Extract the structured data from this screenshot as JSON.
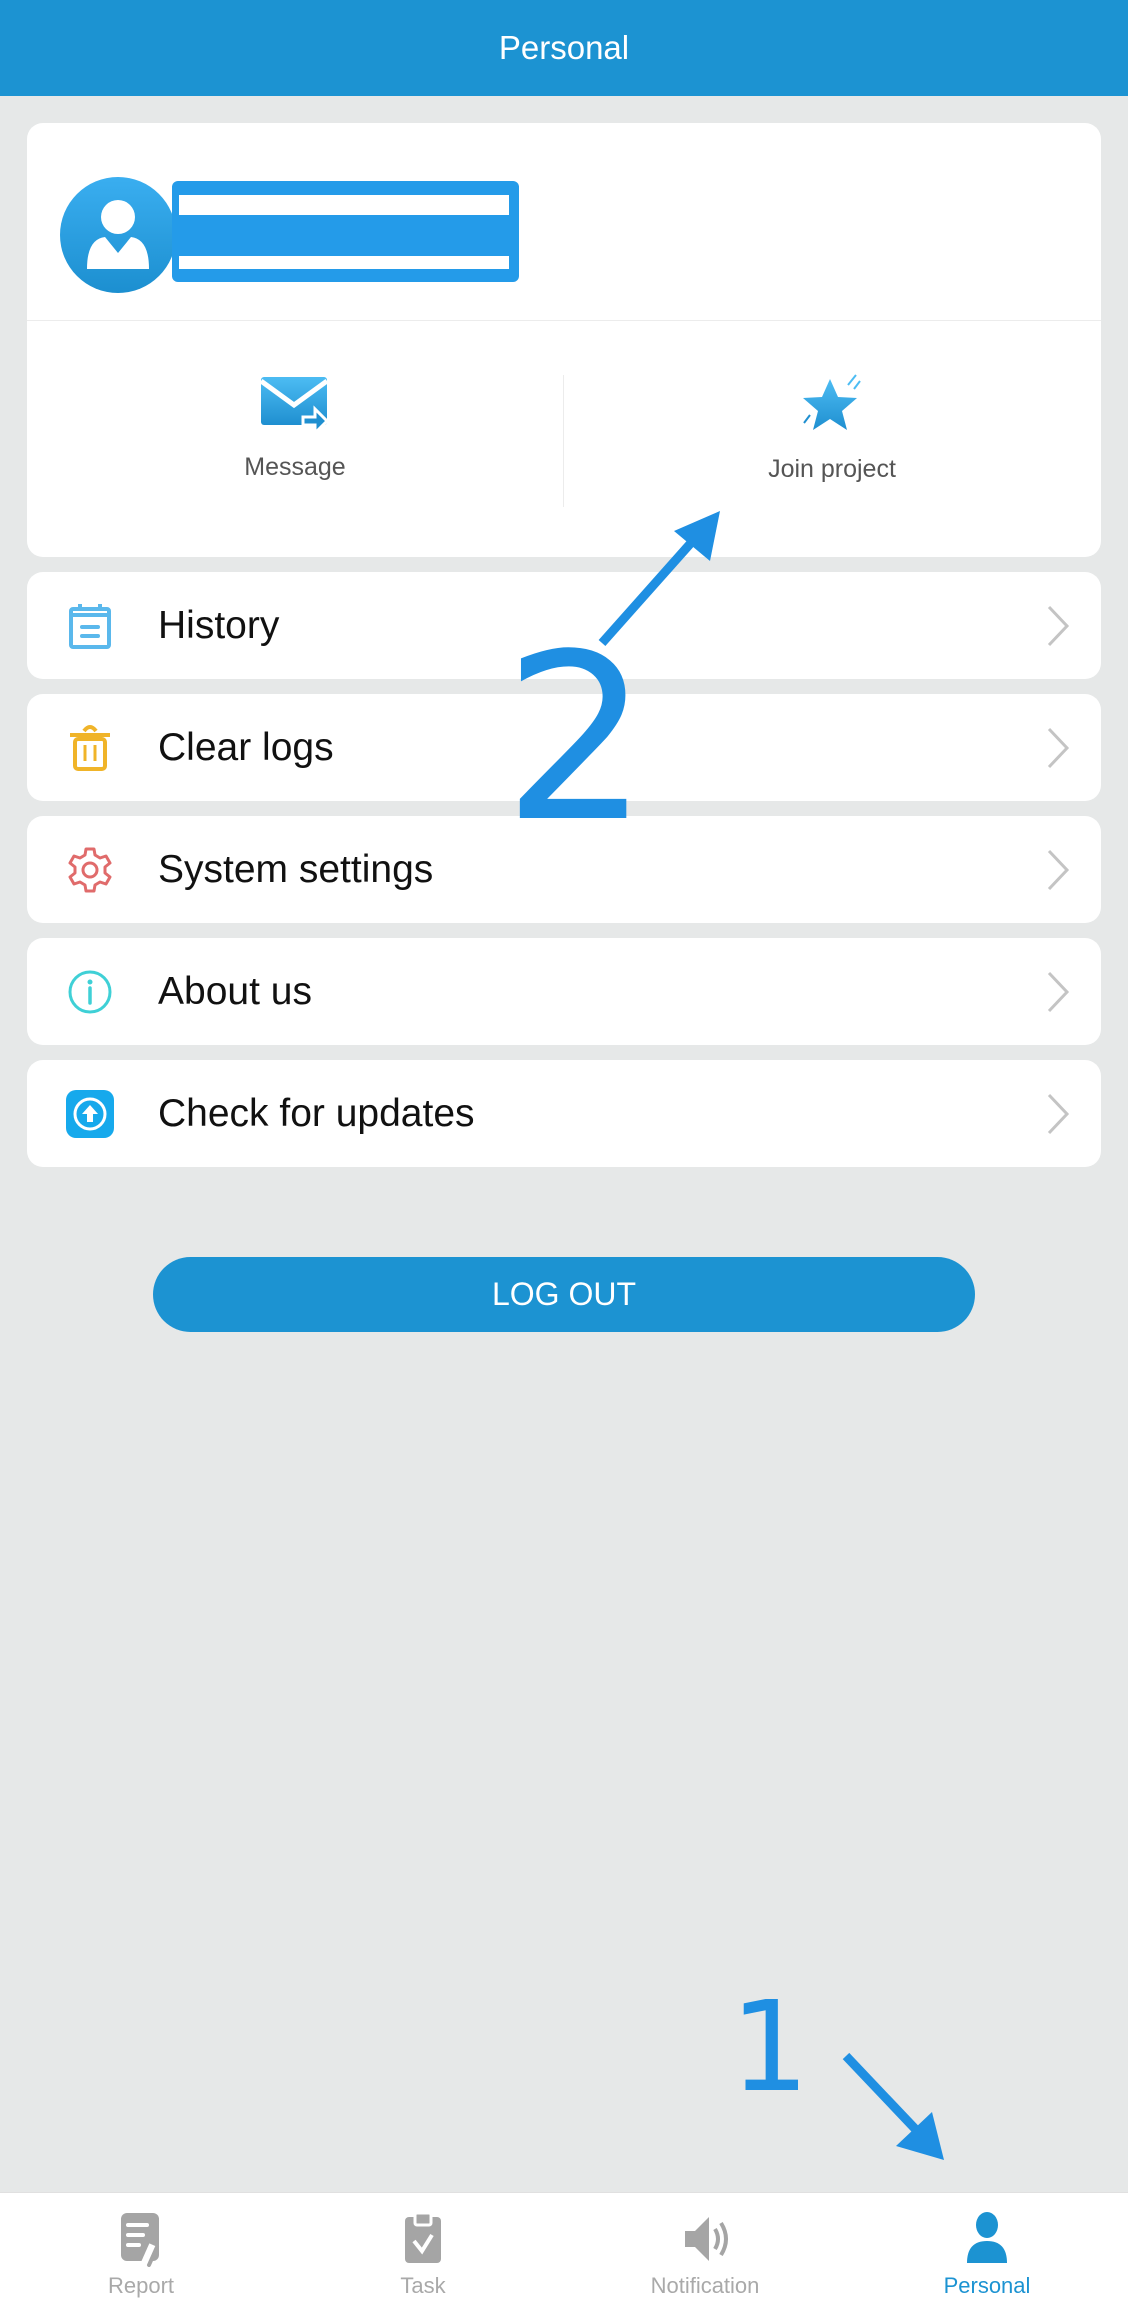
{
  "header": {
    "title": "Personal"
  },
  "profile": {
    "username_redacted": true
  },
  "quick_actions": [
    {
      "label": "Message",
      "icon": "envelope-forward-icon"
    },
    {
      "label": "Join project",
      "icon": "star-icon"
    }
  ],
  "menu": [
    {
      "label": "History",
      "icon": "calendar-list-icon",
      "color": "#5ab8ec"
    },
    {
      "label": "Clear logs",
      "icon": "trash-icon",
      "color": "#f0b429"
    },
    {
      "label": "System settings",
      "icon": "gear-icon",
      "color": "#e06b6b"
    },
    {
      "label": "About us",
      "icon": "info-icon",
      "color": "#3fd0d6"
    },
    {
      "label": "Check for updates",
      "icon": "upload-circle-icon",
      "color": "#16a9ec"
    }
  ],
  "logout": {
    "label": "LOG OUT"
  },
  "bottom_nav": [
    {
      "label": "Report",
      "icon": "report-icon",
      "active": false
    },
    {
      "label": "Task",
      "icon": "clipboard-check-icon",
      "active": false
    },
    {
      "label": "Notification",
      "icon": "speaker-icon",
      "active": false
    },
    {
      "label": "Personal",
      "icon": "person-icon",
      "active": true
    }
  ],
  "annotations": {
    "step1": "1",
    "step2": "2"
  },
  "colors": {
    "primary": "#1c93d2",
    "background": "#e6e8e8",
    "annotation": "#1f8fe2"
  }
}
